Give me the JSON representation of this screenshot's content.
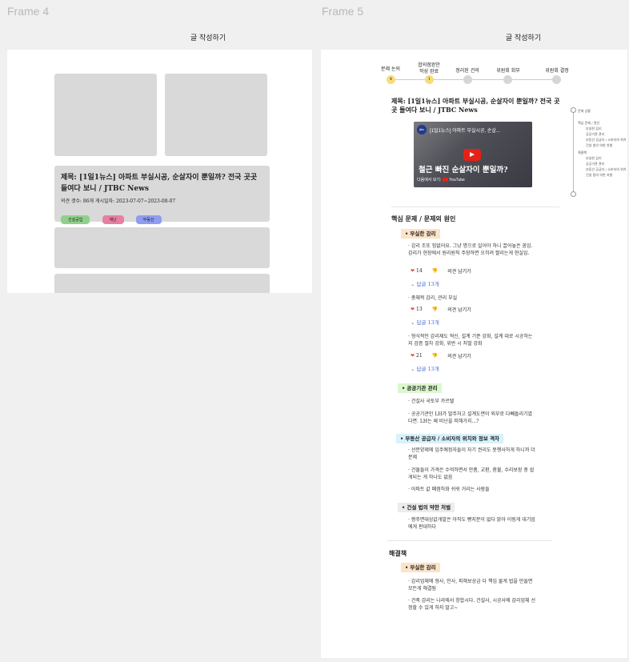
{
  "frames": {
    "frame4": {
      "label": "Frame 4",
      "heading": "글 작성하기"
    },
    "frame5": {
      "label": "Frame 5",
      "heading": "글 작성하기"
    }
  },
  "card": {
    "title": "제목: [1일1뉴스] 아파트 부실시공, 순살자이 뿐일까? 전국 곳곳 들여다 보니 / JTBC News",
    "meta": "의견 갯수: 86개    게시일자: 2023-07-07~2023-08-07",
    "tags": [
      {
        "label": "건설공업",
        "color": "#8fd18a"
      },
      {
        "label": "재난",
        "color": "#e87fa0"
      },
      {
        "label": "부동산",
        "color": "#8f9cf0"
      }
    ]
  },
  "stepper": [
    {
      "label": "문제 논의",
      "num": "4",
      "state": "active"
    },
    {
      "label": "합의점완안\n작성 완료",
      "num": "1",
      "state": "active"
    },
    {
      "label": "정리된 건의",
      "num": "",
      "state": "inactive"
    },
    {
      "label": "위원회 회부",
      "num": "",
      "state": "inactive"
    },
    {
      "label": "위원회 결정",
      "num": "",
      "state": "inactive"
    }
  ],
  "post_title": "제목: [1일1뉴스] 아파트 부실시공, 순살자이 뿐일까? 전국 곳곳 들여다 보니 / JTBC News",
  "video": {
    "caption": "[1일1뉴스] 아파트 부실시공, 순살...",
    "headline": "철근 빠진 순살자이 뿐일까?",
    "watch": "다음에서 보기:",
    "platform": "YouTube"
  },
  "toc": [
    {
      "label": "문제 상황",
      "level": 0
    },
    {
      "label": "핵심 문제 / 원인",
      "level": 0
    },
    {
      "label": "부실한 감리",
      "level": 1
    },
    {
      "label": "공공기관 관리",
      "level": 1
    },
    {
      "label": "부동산 공급자 / 소비자의 위치",
      "level": 1
    },
    {
      "label": "건설 법의 약한 처벌",
      "level": 1
    },
    {
      "label": "해결책",
      "level": 0
    },
    {
      "label": "부실한 감리",
      "level": 1
    },
    {
      "label": "공공기관 관리",
      "level": 1
    },
    {
      "label": "부동산 공급자 / 소비자의 위치",
      "level": 1
    },
    {
      "label": "건설 법의 약한 처벌",
      "level": 1
    }
  ],
  "sections": {
    "core": "핵심 문제 / 문제의 원인",
    "solution": "해결책"
  },
  "topics": {
    "t1": "부실한 감리",
    "t2": "공공기관 관리",
    "t3": "부동산 공급자 / 소비자의 위치와 정보 격차",
    "t4": "건설 법의 약한 처벌",
    "t5": "부실한 감리"
  },
  "points": {
    "p1": "· 감리 조또 힘없어요. 그냥 명으로 일어야 하니 끌어놓은 꼼임. 감리가 현장에서 원리원칙 주장하면 오히려 짤리는게 현실임.",
    "p2": "· 총체적 감리, 관리 부실",
    "p3": "· 형식적인 감리제도 혁신, 설계 기준 강화, 설계 대로 시공하는지 검증 절차 강화, 위반 시 처벌 강화",
    "p4": "· 건설사 국토부 카르텔",
    "p5": "· 공공기관인 LH가 발주처고 설계도면이 외부로 다빼돌리기였다면. LH는 왜 비난을 피해가지...?",
    "p6": "· 선분양제에 입주예정자들이 자기 권리도 못챙사하게 하니까 더문제",
    "p7": "· 건물들이 가격은 수억하면서 안품, 교환, 환불, 수리보장 중 쉽게되는 게 하나도 없음",
    "p8": "· 아파트 값 폐점하화 쉬쉬 거리는 사람들",
    "p9": "· 짱주면대상값개발은 아직도 빵지분이 없다 밝아 이링게 대기업에게 판대하다",
    "p10": "· 감리업체에 형사, 민사, 피해보상금 다 책임 물게 법을 만들면 모든게 해결됨",
    "p11": "· 건축 감리는 나라에서 창합시다. 건설사, 시공사에 감리업체 선정할 수 있게 하지 말고~"
  },
  "reactions": {
    "r1": {
      "likes": "14",
      "opinion": "의견 남기기",
      "replies": "답글 13개"
    },
    "r2": {
      "likes": "13",
      "opinion": "의견 남기기",
      "replies": "답글 13개"
    },
    "r3": {
      "likes": "21",
      "opinion": "의견 남기기",
      "replies": "답글 13개"
    }
  },
  "colors": {
    "peach": "#fde3c8",
    "green": "#dcf7cf",
    "blue": "#d8f2fb",
    "gray": "#ececec",
    "active_dot": "#f7dc7a",
    "inactive_dot": "#d6d6d6",
    "link": "#4a6bd6"
  }
}
